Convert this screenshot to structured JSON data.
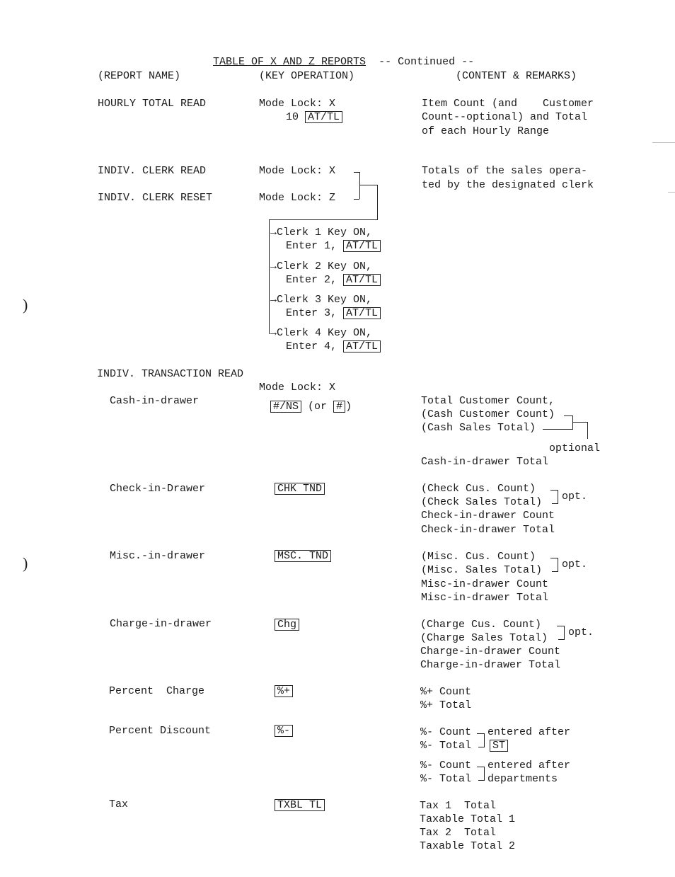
{
  "title": {
    "main": "TABLE OF X AND Z REPORTS",
    "suffix": "-- Continued --"
  },
  "headers": {
    "report_name": "(REPORT NAME)",
    "key_operation": "(KEY OPERATION)",
    "content": "(CONTENT & REMARKS)"
  },
  "hourly": {
    "name": "HOURLY TOTAL READ",
    "mode": "Mode Lock: X",
    "prefix": "10",
    "key": "AT/TL",
    "content": [
      "Item Count (and    Customer",
      "Count--optional) and Total",
      "of each Hourly Range"
    ]
  },
  "clerk": {
    "read_name": "INDIV. CLERK READ",
    "reset_name": "INDIV. CLERK RESET",
    "read_mode": "Mode Lock: X",
    "reset_mode": "Mode Lock: Z",
    "content": [
      "Totals of the sales opera-",
      "ted by the designated clerk"
    ],
    "steps": [
      {
        "line1": "Clerk 1 Key ON,",
        "line2": "Enter 1,",
        "key": "AT/TL"
      },
      {
        "line1": "Clerk 2 Key ON,",
        "line2": "Enter 2,",
        "key": "AT/TL"
      },
      {
        "line1": "Clerk 3 Key ON,",
        "line2": "Enter 3,",
        "key": "AT/TL"
      },
      {
        "line1": "Clerk 4 Key ON,",
        "line2": "Enter 4,",
        "key": "AT/TL"
      }
    ]
  },
  "transaction": {
    "name": "INDIV. TRANSACTION READ",
    "mode": "Mode Lock: X",
    "rows": [
      {
        "name": "Cash-in-drawer",
        "key": "#/NS",
        "alt_open": "(or",
        "alt_key": "#",
        "alt_close": ")",
        "content": [
          "Total Customer Count,",
          "(Cash Customer Count)",
          "(Cash Sales Total)"
        ],
        "note": "optional",
        "after": "Cash-in-drawer Total"
      },
      {
        "name": "Check-in-Drawer",
        "key": "CHK TND",
        "content": [
          "(Check Cus. Count)",
          "(Check Sales Total)",
          "Check-in-drawer Count",
          "Check-in-drawer Total"
        ],
        "note": "opt."
      },
      {
        "name": "Misc.-in-drawer",
        "key": "MSC. TND",
        "content": [
          "(Misc. Cus. Count)",
          "(Misc. Sales Total)",
          "Misc-in-drawer Count",
          "Misc-in-drawer Total"
        ],
        "note": "opt."
      },
      {
        "name": "Charge-in-drawer",
        "key": "Chg",
        "content": [
          "(Charge Cus. Count)",
          "(Charge Sales Total)",
          "Charge-in-drawer Count",
          "Charge-in-drawer Total"
        ],
        "note": "opt."
      },
      {
        "name": "Percent  Charge",
        "key": "%+",
        "content": [
          "%+ Count",
          "%+ Total"
        ]
      },
      {
        "name": "Percent Discount",
        "key": "%-",
        "content": [
          "%- Count",
          "%- Total",
          "%- Count",
          "%- Total"
        ],
        "note1a": "entered after",
        "note1b_key": "ST",
        "note2a": "entered after",
        "note2b": "departments"
      },
      {
        "name": "Tax",
        "key": "TXBL TL",
        "content": [
          "Tax 1  Total",
          "Taxable Total 1",
          "Tax 2  Total",
          "Taxable Total 2"
        ]
      }
    ]
  },
  "margin_marks": [
    ")",
    ")"
  ]
}
